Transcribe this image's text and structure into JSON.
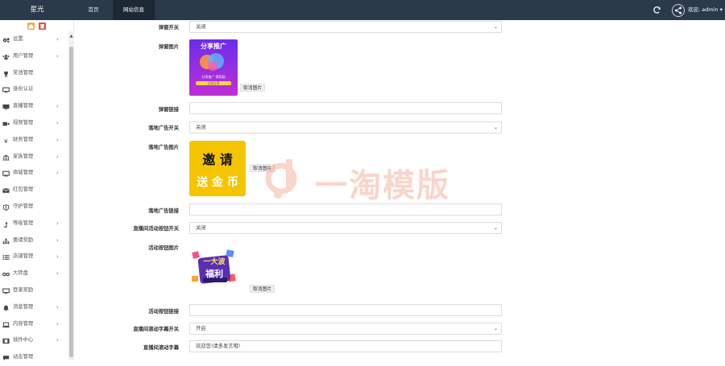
{
  "topbar": {
    "brand": "星光",
    "tabs": [
      {
        "label": "首页"
      },
      {
        "label": "网站信息"
      }
    ],
    "user": "欢迎, admin ▾"
  },
  "sidebar": {
    "items": [
      {
        "label": "设置",
        "icon": "gears-icon",
        "arrow": "›"
      },
      {
        "label": "用户管理",
        "icon": "users-icon",
        "arrow": "›"
      },
      {
        "label": "奖池管理",
        "icon": "trophy-icon",
        "arrow": ""
      },
      {
        "label": "身份认证",
        "icon": "monitor-icon",
        "arrow": ""
      },
      {
        "label": "直播管理",
        "icon": "desktop-icon",
        "arrow": "›"
      },
      {
        "label": "视频管理",
        "icon": "video-camera-icon",
        "arrow": "›"
      },
      {
        "label": "财务管理",
        "icon": "yen-icon",
        "arrow": "›"
      },
      {
        "label": "家族管理",
        "icon": "bank-icon",
        "arrow": "›"
      },
      {
        "label": "商城管理",
        "icon": "tv-icon",
        "arrow": "›"
      },
      {
        "label": "红包管理",
        "icon": "envelope-icon",
        "arrow": ""
      },
      {
        "label": "守护管理",
        "icon": "shield-icon",
        "arrow": ""
      },
      {
        "label": "等级管理",
        "icon": "level-up-icon",
        "arrow": "›"
      },
      {
        "label": "邀请奖励",
        "icon": "sitemap-icon",
        "arrow": "›"
      },
      {
        "label": "店铺管理",
        "icon": "list-icon",
        "arrow": "›"
      },
      {
        "label": "大转盘",
        "icon": "infinity-icon",
        "arrow": "›"
      },
      {
        "label": "登录奖励",
        "icon": "monitor-icon",
        "arrow": ""
      },
      {
        "label": "消息管理",
        "icon": "bell-icon",
        "arrow": "›"
      },
      {
        "label": "内容管理",
        "icon": "laptop-icon",
        "arrow": "›"
      },
      {
        "label": "插件中心",
        "icon": "film-icon",
        "arrow": "›"
      },
      {
        "label": "动态管理",
        "icon": "comment-icon",
        "arrow": ""
      }
    ]
  },
  "form": {
    "popup_switch": {
      "label": "弹窗开关",
      "value": "关闭"
    },
    "popup_image": {
      "label": "弹窗图片",
      "cancel": "取消图片",
      "img_title": "分享推广",
      "img_caption": "分享推广 得奖励",
      "img_button": "立即分享"
    },
    "popup_link": {
      "label": "弹窗链接",
      "value": ""
    },
    "landing_ad_switch": {
      "label": "落地广告开关",
      "value": "关闭"
    },
    "landing_ad_image": {
      "label": "落地广告图片",
      "cancel": "取消图片",
      "line1": "邀 请",
      "line2": "送 金 币"
    },
    "landing_ad_link": {
      "label": "落地广告链接",
      "value": ""
    },
    "live_btn_switch": {
      "label": "直播间活动按钮开关",
      "value": "关闭"
    },
    "activity_btn_image": {
      "label": "活动按钮图片",
      "cancel": "取消图片",
      "text1": "一大波",
      "text2": "福利"
    },
    "activity_btn_link": {
      "label": "活动按钮链接",
      "value": ""
    },
    "scroll_text_switch": {
      "label": "直播间滚动字幕开关",
      "value": "开启"
    },
    "scroll_text": {
      "label": "直播间滚动字幕",
      "value": "欢迎您!请多发言哦!"
    }
  },
  "watermark": {
    "text": "一淘模版"
  },
  "colors": {
    "topbar_bg": "#2b3a4b",
    "active_tab_bg": "#1d2835",
    "mini_btn_orange": "#f0ad4e",
    "mini_btn_red": "#d9534f",
    "promo_purple": "#a22fe0",
    "invite_yellow": "#f5c400",
    "watermark_red": "#f5a38a"
  }
}
